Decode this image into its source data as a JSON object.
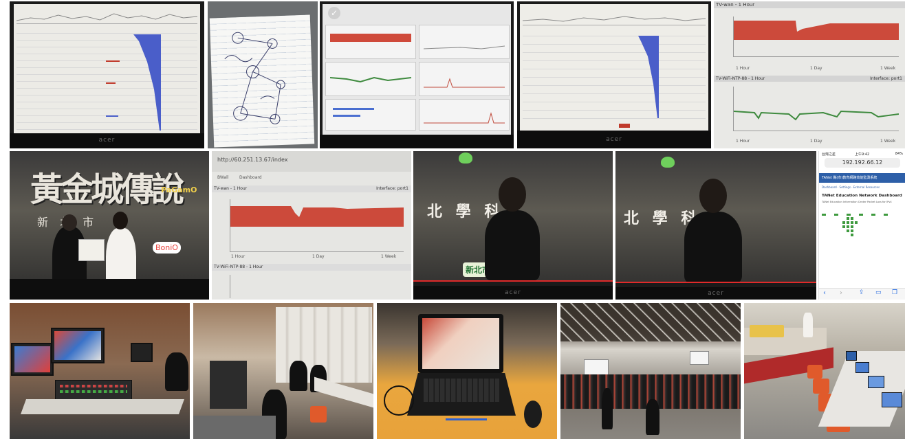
{
  "row1": {
    "monitor_brand": "acer",
    "tile5": {
      "top_chart_title": "TV-wan",
      "top_chart_time": "1 Hour",
      "bottom_chart_title": "TV-WiFi-NTP-88",
      "bottom_chart_time": "1 Hour",
      "range_label_a": "1 Hour",
      "range_label_b": "1 Day",
      "range_label_c": "1 Week",
      "iface_label": "Interface: port1"
    }
  },
  "row2": {
    "tile1": {
      "title_big": "黃金城傳說",
      "title_sub": "新 北 市",
      "brand_badge": "PaGamO",
      "sponsor": "BoniO"
    },
    "tile2": {
      "url": "http://60.251.13.67/index",
      "tab_a": "BWall",
      "tab_b": "Dashboard",
      "top_chart_title": "TV-wan",
      "top_chart_time": "1 Hour",
      "bottom_chart_title": "TV-WiFi-NTP-88",
      "bottom_chart_time": "1 Hour",
      "range_label_a": "1 Hour",
      "range_label_b": "1 Day",
      "range_label_c": "1 Week",
      "iface_label": "Interface: port1"
    },
    "tile3": {
      "stage_text": "北 學 科",
      "logo_text": "新北市",
      "monitor_brand": "acer"
    },
    "tile4": {
      "stage_text": "北 學 科",
      "monitor_brand": "acer"
    },
    "tile5": {
      "status_left": "台灣之星",
      "status_time": "上午9:42",
      "status_battery": "84%",
      "ip": "192.192.66.12",
      "header_title": "TANet 縣(市)教育網路效能監測系統",
      "nav_a": "Dashboard",
      "nav_b": "Settings",
      "nav_c": "External Resources",
      "page_title": "TANet Education Network Dashboard",
      "subtitle": "TANet Education Information Center Packet Loss for IPv4"
    }
  },
  "row3": {}
}
